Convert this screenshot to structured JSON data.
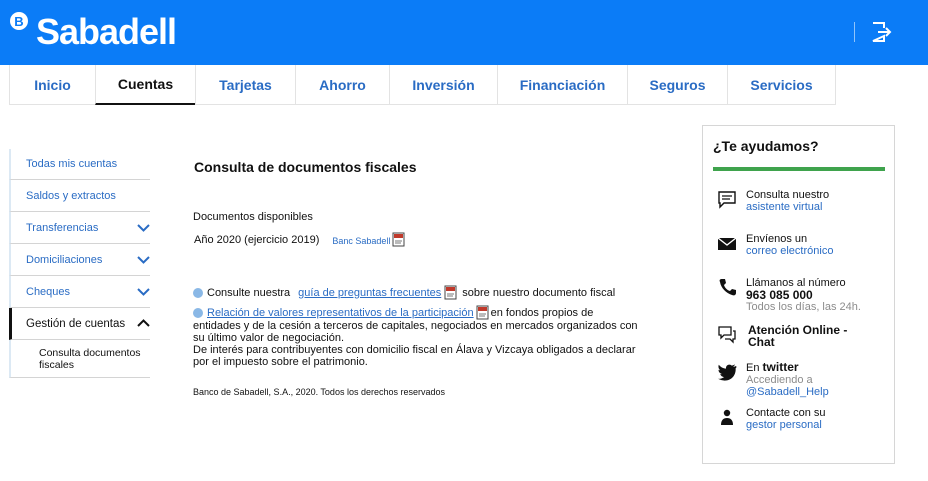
{
  "header": {
    "logo_letter": "B",
    "logo_text": "Sabadell",
    "brand_color": "#0b7cf7",
    "logout_icon": "logout-icon"
  },
  "tabs": [
    {
      "label": "Inicio",
      "active": false
    },
    {
      "label": "Cuentas",
      "active": true
    },
    {
      "label": "Tarjetas",
      "active": false
    },
    {
      "label": "Ahorro",
      "active": false
    },
    {
      "label": "Inversión",
      "active": false
    },
    {
      "label": "Financiación",
      "active": false
    },
    {
      "label": "Seguros",
      "active": false
    },
    {
      "label": "Servicios",
      "active": false
    }
  ],
  "sidebar": {
    "items": [
      {
        "label": "Todas mis cuentas"
      },
      {
        "label": "Saldos y extractos"
      },
      {
        "label": "Transferencias"
      },
      {
        "label": "Domiciliaciones"
      },
      {
        "label": "Cheques"
      },
      {
        "label": "Gestión de cuentas"
      }
    ],
    "sub_item": "Consulta documentos fiscales"
  },
  "main": {
    "title": "Consulta de documentos fiscales",
    "docs_label": "Documentos disponibles",
    "doc_year": "Año 2020 (ejercicio 2019)",
    "doc_link": "Banc Sabadell",
    "info": {
      "line1_pre": "Consulte nuestra",
      "line1_link": "guía de preguntas frecuentes",
      "line1_post": "sobre nuestro documento fiscal",
      "line2_link": "Relación de valores representativos de la participación",
      "line2_post": "en fondos propios de",
      "line3": "entidades y de la cesión a terceros de capitales, negociados en mercados organizados con",
      "line4": "su último valor de negociación.",
      "line5": "De interés para contribuyentes con domicilio fiscal en Álava y Vizcaya obligados a declarar",
      "line6": "por el impuesto sobre el patrimonio."
    },
    "copyright": "Banco de Sabadell, S.A., 2020. Todos los derechos reservados"
  },
  "help": {
    "title": "¿Te ayudamos?",
    "accent_color": "#3fa34d",
    "assistant": {
      "text": "Consulta nuestro",
      "link": "asistente virtual"
    },
    "email": {
      "text": "Envíenos un",
      "link": "correo electrónico"
    },
    "phone": {
      "text": "Llámanos al número",
      "number": "963 085 000",
      "hours": "Todos los días, las 24h."
    },
    "chat": {
      "line1": "Atención Online -",
      "line2": "Chat"
    },
    "twitter": {
      "pre": "En",
      "name": "twitter",
      "sub": "Accediendo a",
      "handle": "@Sabadell_Help"
    },
    "manager": {
      "text": "Contacte con su",
      "link": "gestor personal"
    }
  }
}
